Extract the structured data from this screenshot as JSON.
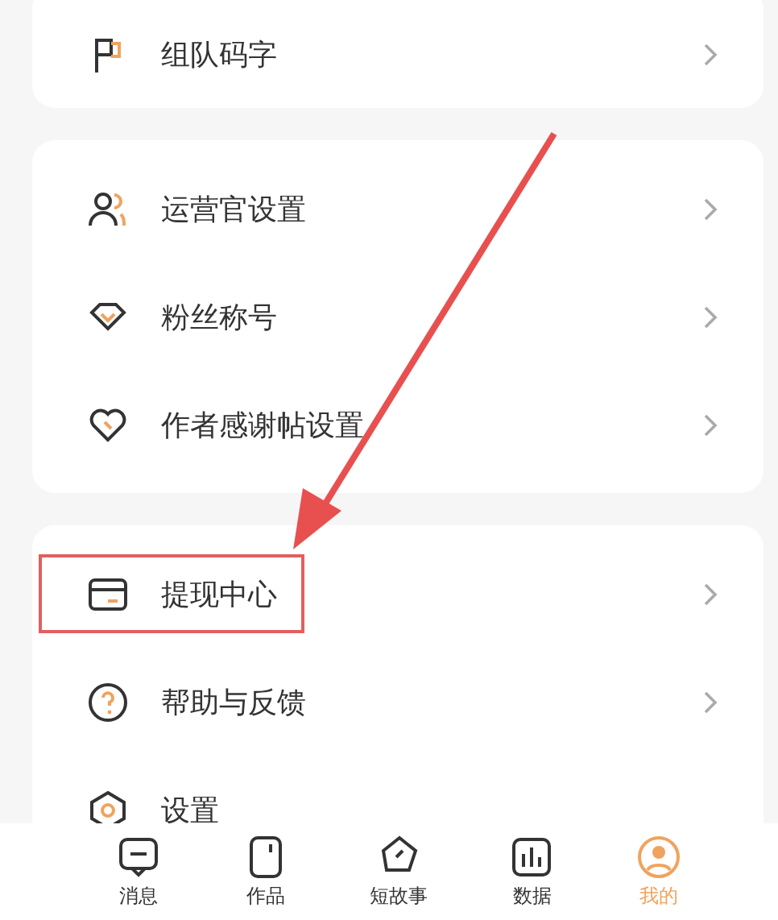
{
  "cards": [
    {
      "rows": [
        {
          "label": "组队码字",
          "highlighted": false
        }
      ]
    },
    {
      "rows": [
        {
          "label": "运营官设置",
          "highlighted": false
        },
        {
          "label": "粉丝称号",
          "highlighted": false
        },
        {
          "label": "作者感谢帖设置",
          "highlighted": false
        }
      ]
    },
    {
      "rows": [
        {
          "label": "提现中心",
          "highlighted": true
        },
        {
          "label": "帮助与反馈",
          "highlighted": false
        },
        {
          "label": "设置",
          "highlighted": false
        }
      ]
    }
  ],
  "tab_bar": [
    {
      "label": "消息",
      "selected": false
    },
    {
      "label": "作品",
      "selected": false
    },
    {
      "label": "短故事",
      "selected": false
    },
    {
      "label": "数据",
      "selected": false
    },
    {
      "label": "我的",
      "selected": true
    }
  ]
}
